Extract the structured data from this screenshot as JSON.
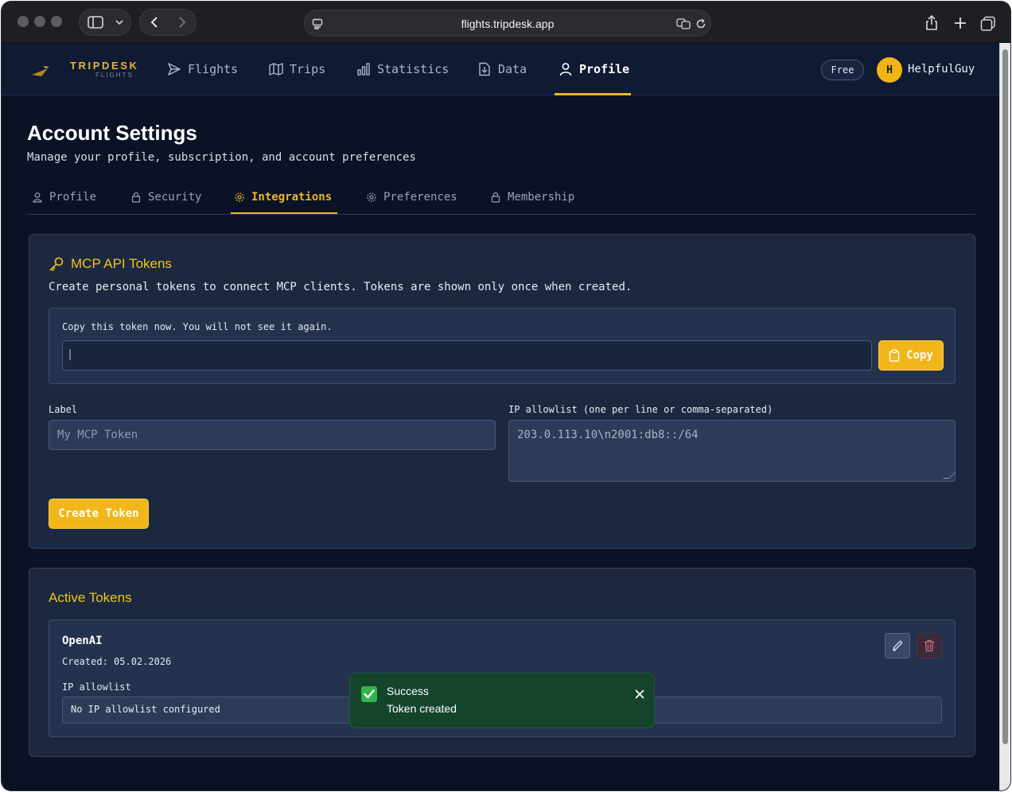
{
  "browser": {
    "url": "flights.tripdesk.app"
  },
  "brand": {
    "name": "TRIPDESK",
    "sub": "FLIGHTS",
    "accent": "#e9b52b"
  },
  "nav": {
    "items": [
      {
        "label": "Flights",
        "icon": "paper-plane-icon"
      },
      {
        "label": "Trips",
        "icon": "map-icon"
      },
      {
        "label": "Statistics",
        "icon": "bar-chart-icon"
      },
      {
        "label": "Data",
        "icon": "file-download-icon"
      },
      {
        "label": "Profile",
        "icon": "user-icon",
        "active": true
      }
    ],
    "plan_badge": "Free",
    "avatar_initial": "H",
    "username": "HelpfulGuy"
  },
  "page": {
    "title": "Account Settings",
    "subtitle": "Manage your profile, subscription, and account preferences"
  },
  "tabs": [
    {
      "label": "Profile",
      "icon": "user-icon"
    },
    {
      "label": "Security",
      "icon": "lock-icon"
    },
    {
      "label": "Integrations",
      "icon": "gear-icon",
      "active": true
    },
    {
      "label": "Preferences",
      "icon": "gear-icon"
    },
    {
      "label": "Membership",
      "icon": "lock-icon"
    }
  ],
  "mcp": {
    "title": "MCP API Tokens",
    "description": "Create personal tokens to connect MCP clients. Tokens are shown only once when created.",
    "token_notice": "Copy this token now. You will not see it again.",
    "copy_label": "Copy",
    "label_field": {
      "label": "Label",
      "placeholder": "My MCP Token"
    },
    "ip_field": {
      "label": "IP allowlist (one per line or comma-separated)",
      "placeholder": "203.0.113.10\\n2001:db8::/64"
    },
    "create_label": "Create Token"
  },
  "active_tokens": {
    "title": "Active Tokens",
    "items": [
      {
        "name": "OpenAI",
        "created": "Created: 05.02.2026",
        "ip_label": "IP allowlist",
        "ip_value": "No IP allowlist configured"
      }
    ]
  },
  "toast": {
    "title": "Success",
    "message": "Token created",
    "color": "#15442c"
  }
}
